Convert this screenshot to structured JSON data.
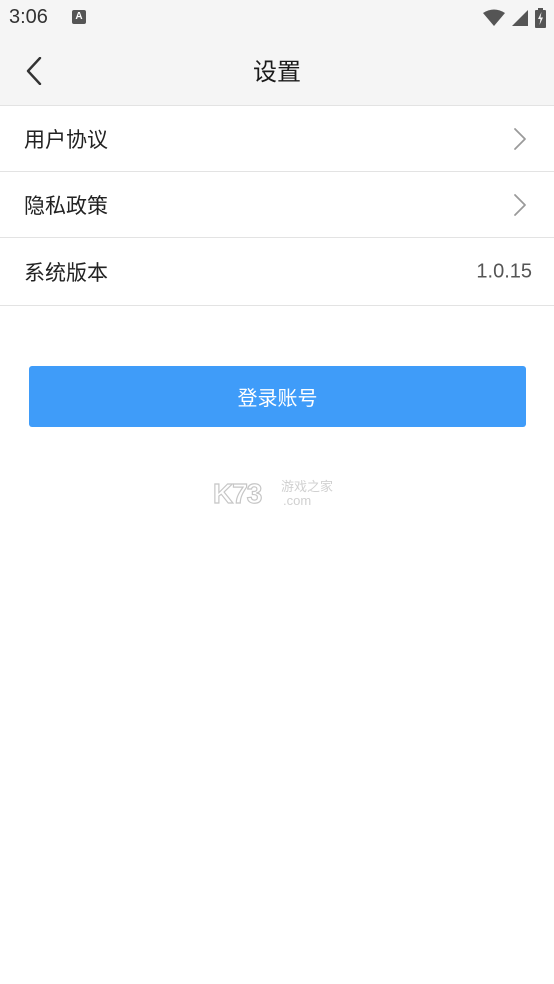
{
  "status_bar": {
    "time": "3:06",
    "notification_icon": "A"
  },
  "header": {
    "title": "设置",
    "back_icon": "chevron-left-icon"
  },
  "settings": {
    "items": [
      {
        "label": "用户协议",
        "trailing": "chevron-right-icon"
      },
      {
        "label": "隐私政策",
        "trailing": "chevron-right-icon"
      },
      {
        "label": "系统版本",
        "value": "1.0.15"
      }
    ]
  },
  "actions": {
    "login_label": "登录账号"
  },
  "watermark": {
    "brand": "K73",
    "tagline": "游戏之家",
    "domain": ".com"
  },
  "colors": {
    "accent": "#3f9cf9",
    "bar_background": "#f5f5f5",
    "divider": "#e3e3e3"
  }
}
